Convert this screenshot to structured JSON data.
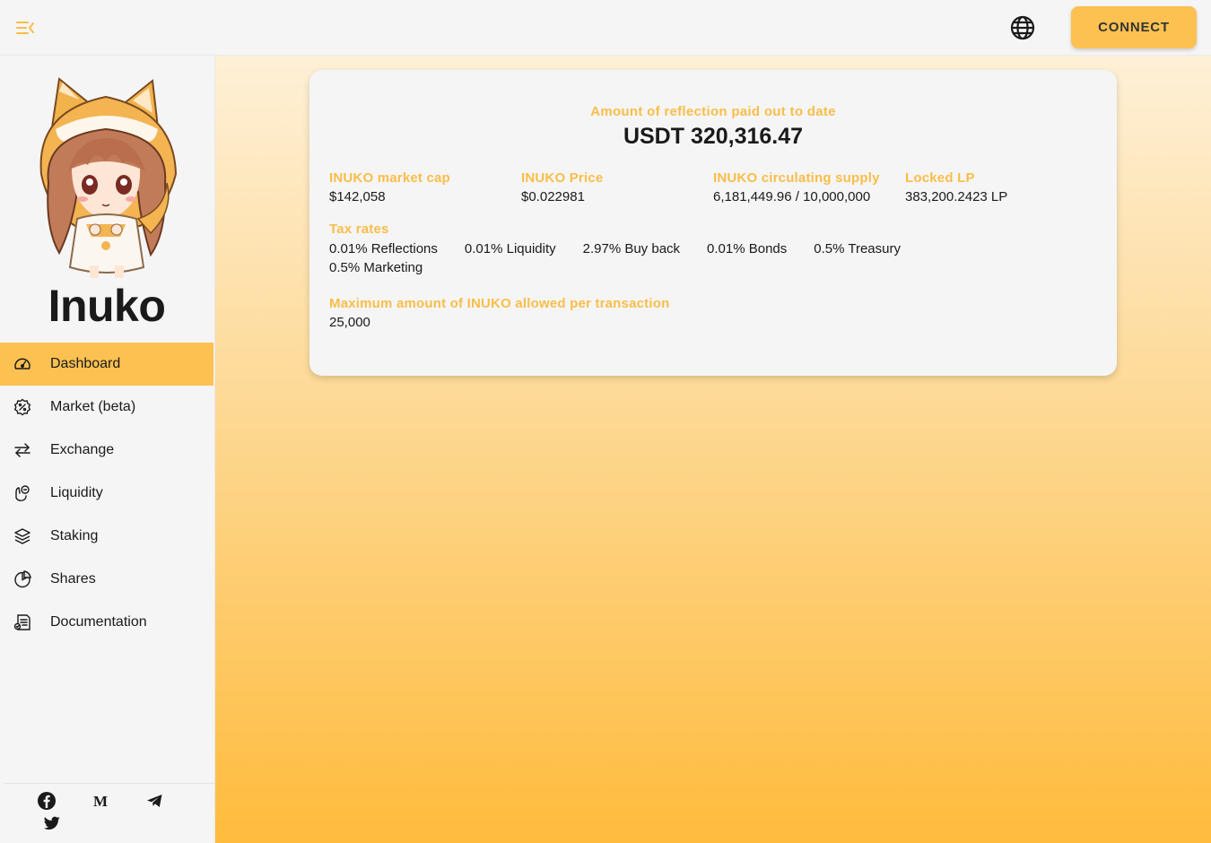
{
  "topbar": {
    "menu_icon": "menu-collapse-icon",
    "language_icon": "globe-icon",
    "connect_label": "CONNECT"
  },
  "sidebar": {
    "brand": "Inuko",
    "mascot": "chibi-fox-girl-mascot",
    "items": [
      {
        "label": "Dashboard",
        "icon": "speedometer-icon",
        "active": true
      },
      {
        "label": "Market (beta)",
        "icon": "percent-badge-icon",
        "active": false
      },
      {
        "label": "Exchange",
        "icon": "swap-arrows-icon",
        "active": false
      },
      {
        "label": "Liquidity",
        "icon": "coins-hand-icon",
        "active": false
      },
      {
        "label": "Staking",
        "icon": "layers-icon",
        "active": false
      },
      {
        "label": "Shares",
        "icon": "pie-chart-icon",
        "active": false
      },
      {
        "label": "Documentation",
        "icon": "document-icon",
        "active": false
      }
    ],
    "socials": [
      "facebook-icon",
      "medium-icon",
      "telegram-icon",
      "twitter-icon"
    ]
  },
  "dashboard": {
    "reflection_label": "Amount of reflection paid out to date",
    "reflection_value": "USDT 320,316.47",
    "stats": [
      {
        "label": "INUKO market cap",
        "value": "$142,058"
      },
      {
        "label": "INUKO Price",
        "value": "$0.022981"
      },
      {
        "label": "INUKO circulating supply",
        "value": "6,181,449.96 / 10,000,000"
      },
      {
        "label": "Locked LP",
        "value": "383,200.2423 LP"
      }
    ],
    "tax_label": "Tax rates",
    "tax_rates": [
      "0.01% Reflections",
      "0.01% Liquidity",
      "2.97% Buy back",
      "0.01% Bonds",
      "0.5% Treasury",
      "0.5% Marketing"
    ],
    "max_tx_label": "Maximum amount of INUKO allowed per transaction",
    "max_tx_value": "25,000"
  },
  "colors": {
    "accent": "#fcc151",
    "label": "#f9bd49",
    "gradient_top": "#fef0d7",
    "gradient_bottom": "#ffbb3c"
  }
}
